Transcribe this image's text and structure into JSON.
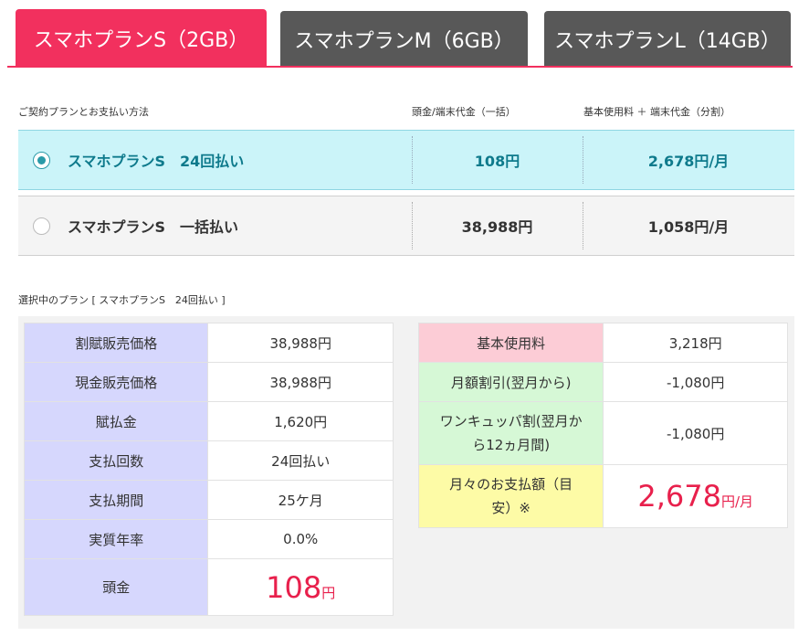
{
  "tabs": [
    {
      "label": "スマホプランS（2GB）"
    },
    {
      "label": "スマホプランM（6GB）"
    },
    {
      "label": "スマホプランL（14GB）"
    }
  ],
  "plan_table": {
    "headers": [
      "ご契約プランとお支払い方法",
      "頭金/端末代金（一括）",
      "基本使用料 ＋ 端末代金（分割）"
    ],
    "rows": [
      {
        "name": "スマホプランS　24回払い",
        "v1": "108円",
        "v2": "2,678円/月",
        "selected": true
      },
      {
        "name": "スマホプランS　一括払い",
        "v1": "38,988円",
        "v2": "1,058円/月",
        "selected": false
      }
    ]
  },
  "selected_caption": "選択中のプラン [ スマホプランS　24回払い ]",
  "left_details": [
    {
      "key": "割賦販売価格",
      "value": "38,988円"
    },
    {
      "key": "現金販売価格",
      "value": "38,988円"
    },
    {
      "key": "賦払金",
      "value": "1,620円"
    },
    {
      "key": "支払回数",
      "value": "24回払い"
    },
    {
      "key": "支払期間",
      "value": "25ケ月"
    },
    {
      "key": "実質年率",
      "value": "0.0%"
    },
    {
      "key": "頭金",
      "value_big": "108",
      "value_unit": "円"
    }
  ],
  "right_details": [
    {
      "key": "基本使用料",
      "value": "3,218円"
    },
    {
      "key": "月額割引(翌月から)",
      "value": "-1,080円"
    },
    {
      "key_line1": "ワンキュッパ割(翌月か",
      "key_line2": "ら12ヵ月間)",
      "value": "-1,080円"
    },
    {
      "key_line1": "月々のお支払額（目",
      "key_line2": "安）※",
      "value_big": "2,678",
      "value_unit": "円/月"
    }
  ],
  "colors": {
    "accent": "#f2305e",
    "tab_inactive": "#585858",
    "selected_row": "#cbf4f9",
    "price_red": "#e8204c"
  }
}
